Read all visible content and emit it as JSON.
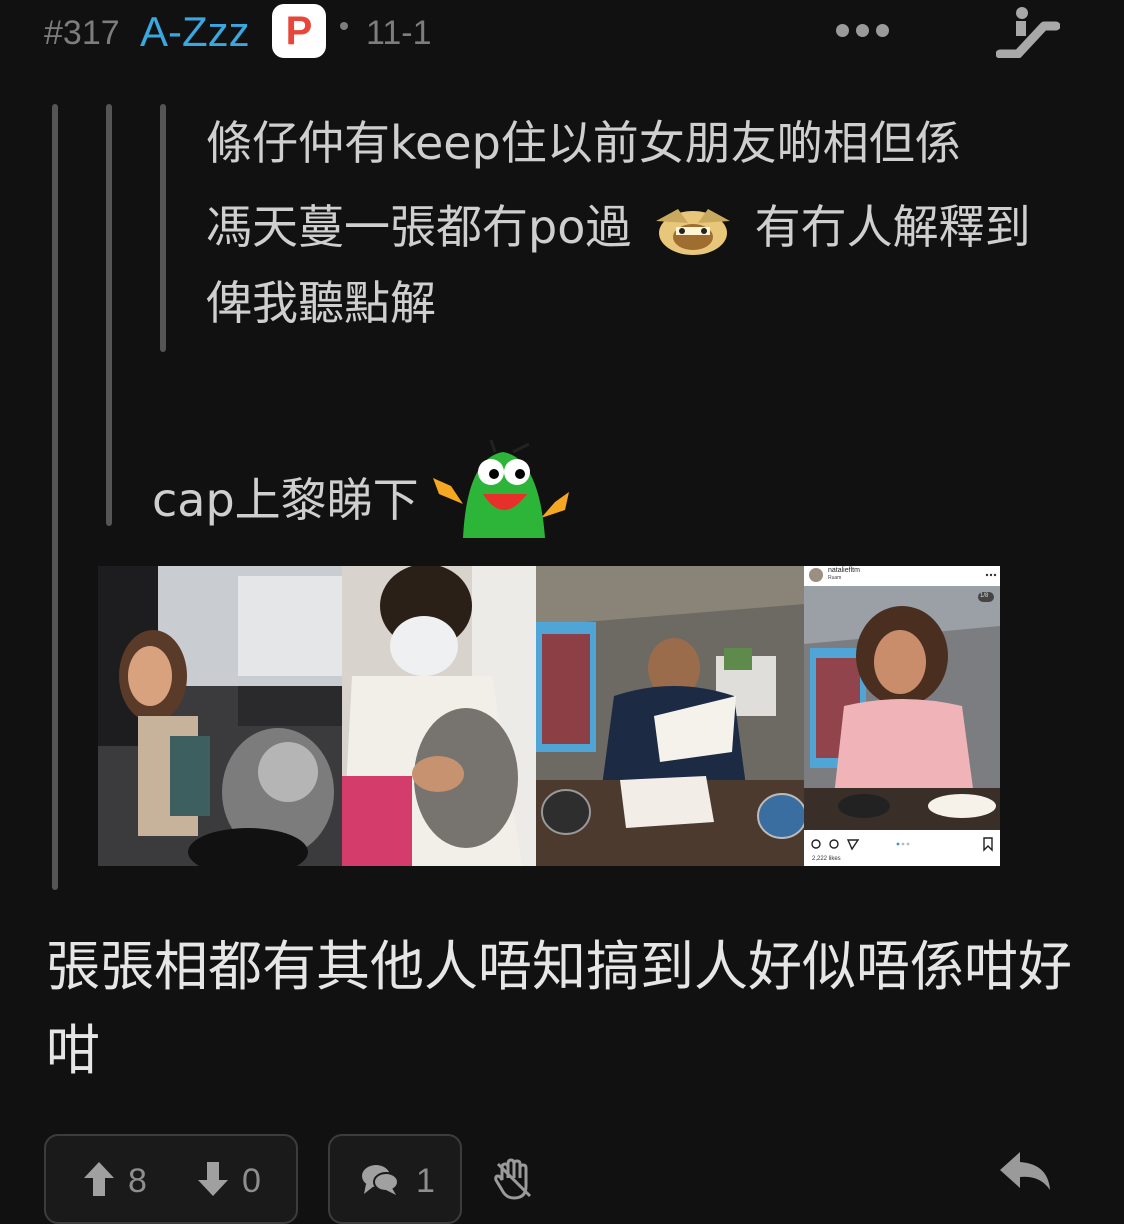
{
  "header": {
    "post_number": "#317",
    "username": "A-Zzz",
    "badge": "P",
    "time": "11-1"
  },
  "quote": {
    "inner_line1": "條仔仲有keep住以前女朋友啲相但係",
    "inner_line2_a": "馮天蔓一張都冇po過",
    "inner_line2_b": "有冇人解釋到",
    "inner_line3": "俾我聽點解",
    "outer_text": "cap上黎睇下"
  },
  "images": [
    {
      "name": "photo-woman-car-dog"
    },
    {
      "name": "photo-man-mask-dog"
    },
    {
      "name": "photo-man-restaurant"
    },
    {
      "name": "photo-instagram-woman"
    }
  ],
  "instagram": {
    "handle": "nataliefltm",
    "sub": "Ruam",
    "counter": "1/8",
    "likes": "2,222 likes"
  },
  "main_text": "張張相都有其他人唔知搞到人好似唔係咁好咁",
  "actions": {
    "upvotes": "8",
    "downvotes": "0",
    "comments": "1"
  },
  "colors": {
    "background": "#111111",
    "username": "#3aa8e0",
    "badge_text": "#e8463a"
  }
}
